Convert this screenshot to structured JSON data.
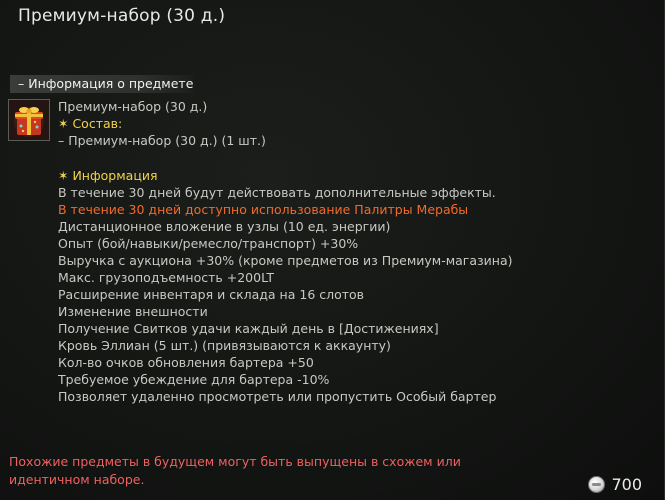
{
  "tooltip": {
    "title": "Премиум-набор (30 д.)",
    "section_header": "– Информация о предмете",
    "item_icon": "gift-box-icon",
    "lines": [
      {
        "text": "Премиум-набор (30 д.)",
        "color": "#c9c9c3"
      },
      {
        "text": "✶ Состав:",
        "color": "#f1d24a"
      },
      {
        "text": "– Премиум-набор (30 д.) (1 шт.)",
        "color": "#c9c9c3"
      },
      {
        "text": "",
        "color": "#c9c9c3"
      },
      {
        "text": "✶ Информация",
        "color": "#f1d24a"
      },
      {
        "text": "В течение 30 дней будут действовать дополнительные эффекты.",
        "color": "#c9c9c3"
      },
      {
        "text": "В течение 30 дней доступно использование Палитры Мерабы",
        "color": "#f26a2a"
      },
      {
        "text": "Дистанционное вложение в узлы (10 ед. энергии)",
        "color": "#c9c9c3"
      },
      {
        "text": "Опыт (бой/навыки/ремесло/транспорт) +30%",
        "color": "#c9c9c3"
      },
      {
        "text": "Выручка с аукциона +30% (кроме предметов из Премиум-магазина)",
        "color": "#c9c9c3"
      },
      {
        "text": "Макс. грузоподъемность +200LT",
        "color": "#c9c9c3"
      },
      {
        "text": "Расширение инвентаря и склада на 16 слотов",
        "color": "#c9c9c3"
      },
      {
        "text": "Изменение внешности",
        "color": "#c9c9c3"
      },
      {
        "text": "Получение Свитков удачи каждый день в [Достижениях]",
        "color": "#c9c9c3"
      },
      {
        "text": "Кровь Эллиан (5 шт.) (привязываются к аккаунту)",
        "color": "#c9c9c3"
      },
      {
        "text": "Кол-во очков обновления бартера +50",
        "color": "#c9c9c3"
      },
      {
        "text": "Требуемое убеждение для бартера -10%",
        "color": "#c9c9c3"
      },
      {
        "text": "Позволяет удаленно просмотреть или пропустить Особый бартер",
        "color": "#c9c9c3"
      }
    ],
    "note": "Похожие предметы в будущем могут быть выпущены в схожем или идентичном наборе.",
    "price": {
      "icon": "silver-coin-icon",
      "value": "700"
    }
  }
}
